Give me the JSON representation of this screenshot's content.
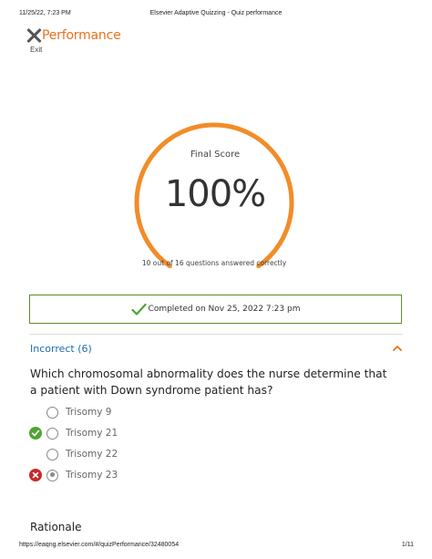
{
  "print_header": {
    "datetime": "11/25/22, 7:23 PM",
    "page_title": "Elsevier Adaptive Quizzing - Quiz performance"
  },
  "header": {
    "title": "Performance",
    "exit_label": "Exit",
    "accent_color": "#e9711c"
  },
  "score": {
    "label": "Final Score",
    "value": "100%",
    "fraction": 1.0,
    "subtitle": "10 out of 16 questions answered correctly",
    "ring_color": "#f28c28"
  },
  "completion": {
    "text": "Completed on Nov 25, 2022 7:23 pm",
    "border_color": "#5c8f2b",
    "icon": "check-icon"
  },
  "section": {
    "title": "Incorrect (6)",
    "title_color": "#1a6eb5",
    "toggle_icon": "chevron-up-icon"
  },
  "question": {
    "text": "Which chromosomal abnormality does the nurse determine that a patient with Down syndrome patient has?",
    "options": [
      {
        "label": "Trisomy 9",
        "status": "none",
        "selected": false
      },
      {
        "label": "Trisomy 21",
        "status": "correct",
        "selected": false
      },
      {
        "label": "Trisomy 22",
        "status": "none",
        "selected": false
      },
      {
        "label": "Trisomy 23",
        "status": "incorrect",
        "selected": true
      }
    ],
    "correct_color": "#4ca630",
    "incorrect_color": "#c62a2a"
  },
  "rationale": {
    "title": "Rationale"
  },
  "print_footer": {
    "url": "https://eaqng.elsevier.com/#/quizPerformance/32480054",
    "page": "1/11"
  }
}
